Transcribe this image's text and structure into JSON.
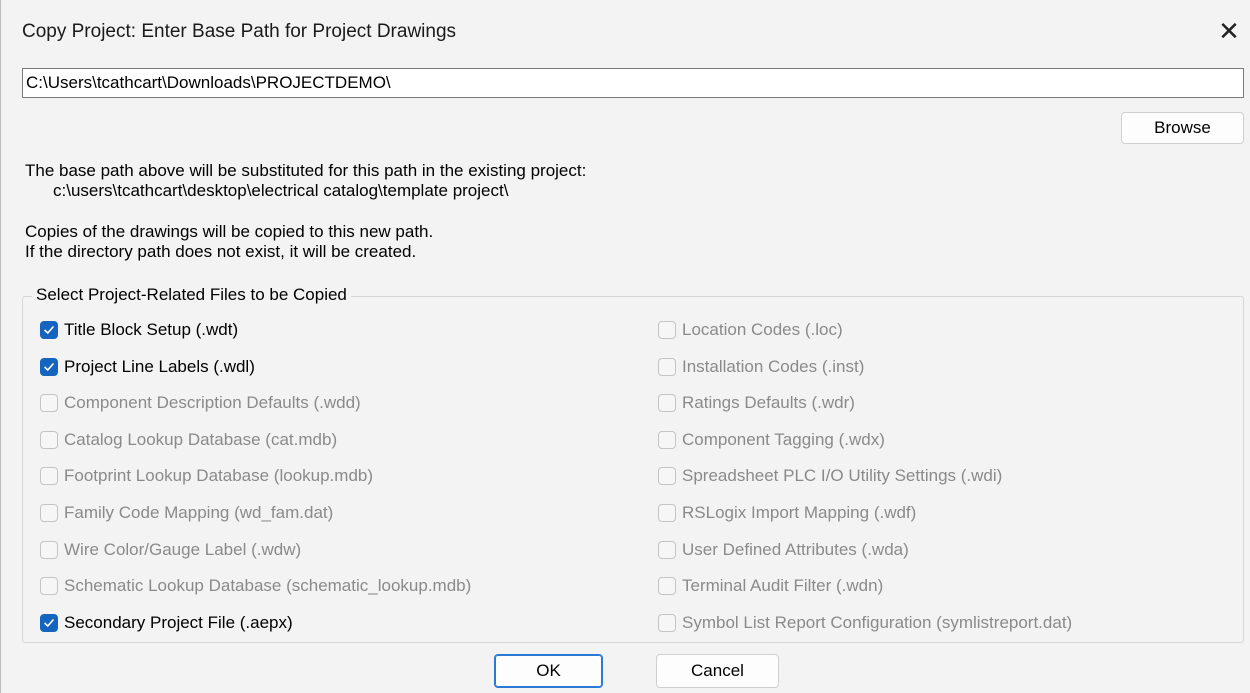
{
  "dialog": {
    "title": "Copy Project: Enter Base Path for Project Drawings",
    "close_glyph": "✕"
  },
  "path": {
    "value": "C:\\Users\\tcathcart\\Downloads\\PROJECTDEMO\\"
  },
  "browse_label": "Browse",
  "info": {
    "line1": "The base path above will be substituted for this path in the existing project:",
    "old_path": "c:\\users\\tcathcart\\desktop\\electrical catalog\\template project\\",
    "line3": "Copies of the drawings will be copied to this new path.",
    "line4": "If the directory path does not exist, it will be created."
  },
  "group_title": "Select Project-Related Files to be Copied",
  "left_items": [
    {
      "label": "Title Block Setup (.wdt)",
      "checked": true,
      "enabled": true
    },
    {
      "label": "Project Line Labels (.wdl)",
      "checked": true,
      "enabled": true
    },
    {
      "label": "Component Description Defaults (.wdd)",
      "checked": false,
      "enabled": false
    },
    {
      "label": "Catalog Lookup Database (cat.mdb)",
      "checked": false,
      "enabled": false
    },
    {
      "label": "Footprint Lookup Database (lookup.mdb)",
      "checked": false,
      "enabled": false
    },
    {
      "label": "Family Code Mapping (wd_fam.dat)",
      "checked": false,
      "enabled": false
    },
    {
      "label": "Wire Color/Gauge Label (.wdw)",
      "checked": false,
      "enabled": false
    },
    {
      "label": "Schematic Lookup Database (schematic_lookup.mdb)",
      "checked": false,
      "enabled": false
    },
    {
      "label": "Secondary Project File (.aepx)",
      "checked": true,
      "enabled": true
    }
  ],
  "right_items": [
    {
      "label": "Location Codes (.loc)",
      "checked": false,
      "enabled": false
    },
    {
      "label": "Installation Codes (.inst)",
      "checked": false,
      "enabled": false
    },
    {
      "label": "Ratings Defaults (.wdr)",
      "checked": false,
      "enabled": false
    },
    {
      "label": "Component Tagging (.wdx)",
      "checked": false,
      "enabled": false
    },
    {
      "label": "Spreadsheet PLC I/O Utility Settings (.wdi)",
      "checked": false,
      "enabled": false
    },
    {
      "label": "RSLogix Import Mapping (.wdf)",
      "checked": false,
      "enabled": false
    },
    {
      "label": "User Defined Attributes (.wda)",
      "checked": false,
      "enabled": false
    },
    {
      "label": "Terminal Audit Filter (.wdn)",
      "checked": false,
      "enabled": false
    },
    {
      "label": "Symbol List Report Configuration (symlistreport.dat)",
      "checked": false,
      "enabled": false
    }
  ],
  "ok_label": "OK",
  "cancel_label": "Cancel",
  "colors": {
    "accent": "#1565c0",
    "disabled_text": "#8a8a8a",
    "background": "#f3f3f3"
  }
}
